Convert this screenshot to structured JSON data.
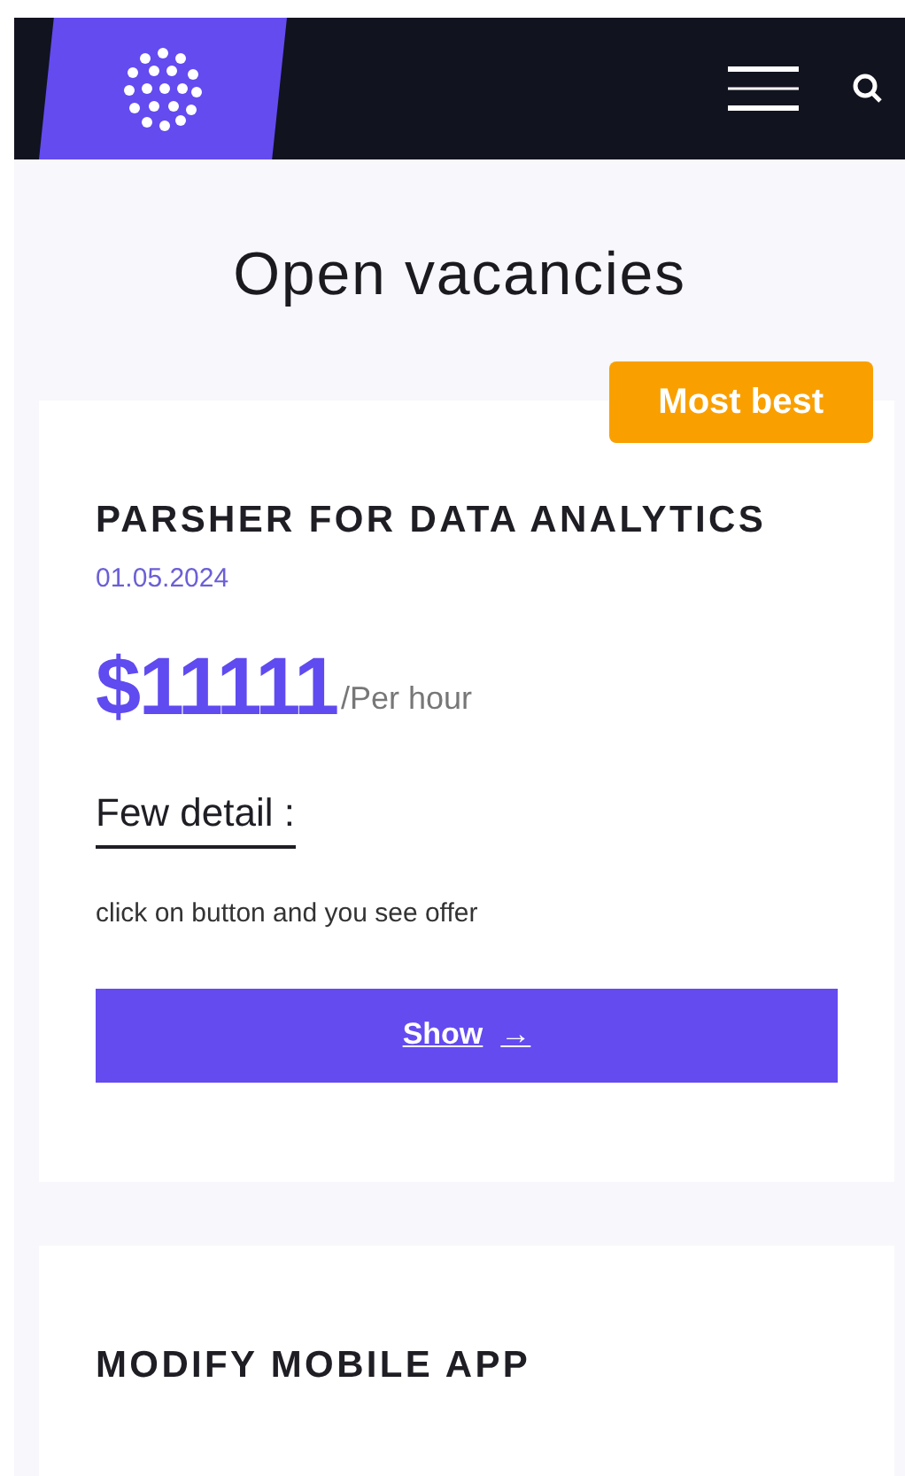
{
  "page_title": "Open vacancies",
  "vacancies": [
    {
      "badge": "Most best",
      "title": "PARSHER FOR DATA ANALYTICS",
      "date": "01.05.2024",
      "price": "$11111",
      "price_unit": "/Per hour",
      "details_heading": "Few detail :",
      "details": "click on button and you see offer",
      "button": {
        "label": "Show",
        "arrow": "→"
      }
    },
    {
      "title": "MODIFY MOBILE APP"
    }
  ]
}
